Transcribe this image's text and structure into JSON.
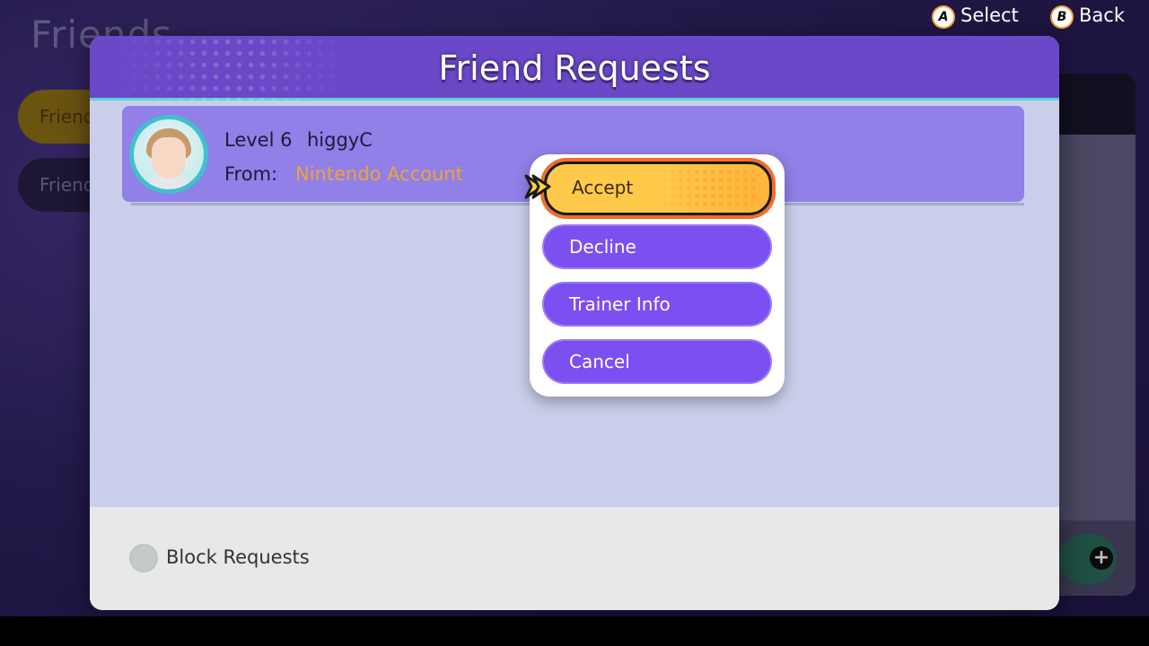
{
  "background": {
    "title": "Friends",
    "tabs": [
      {
        "label": "Friends"
      },
      {
        "label": "Friend Requests"
      }
    ]
  },
  "dialog": {
    "title": "Friend Requests",
    "request": {
      "level_label": "Level 6",
      "name": "higgyC",
      "from_label": "From:",
      "from_value": "Nintendo Account"
    },
    "menu": {
      "accept": "Accept",
      "decline": "Decline",
      "trainer_info": "Trainer Info",
      "cancel": "Cancel"
    },
    "footer": {
      "block_label": "Block Requests"
    }
  },
  "hints": {
    "select_button": "A",
    "select_label": "Select",
    "back_button": "B",
    "back_label": "Back"
  },
  "colors": {
    "header": "#6a48c8",
    "accent_teal": "#5ad2d8",
    "menu_button": "#7c4ff0",
    "selected_button": "#ffc94a",
    "selected_outline": "#f36d2a",
    "account_text": "#f0a23a"
  }
}
